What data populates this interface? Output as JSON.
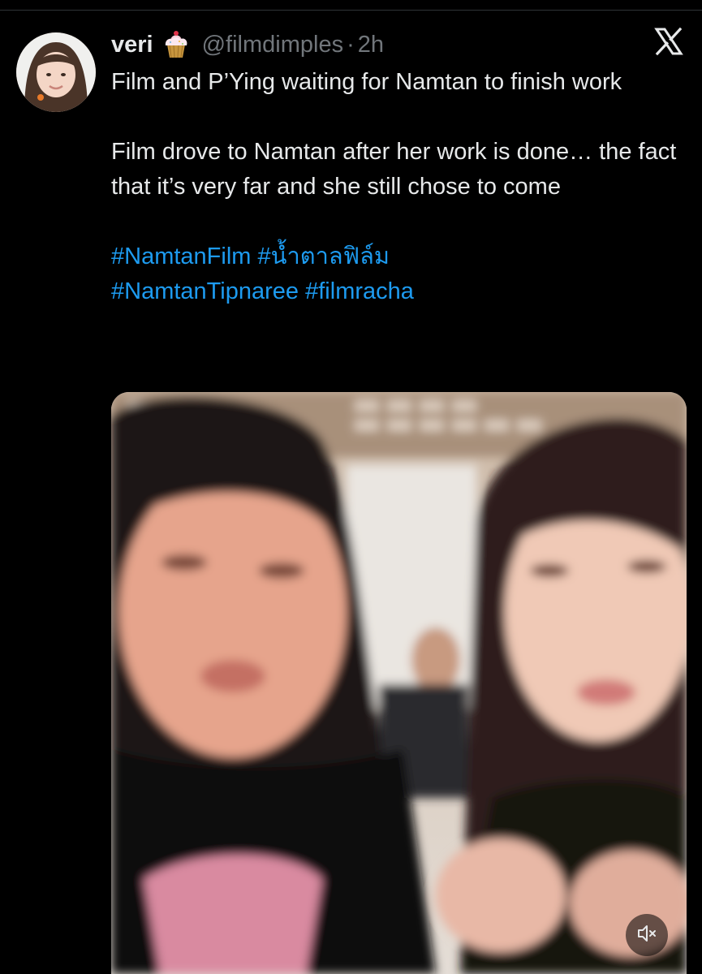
{
  "tweet": {
    "author": {
      "display_name": "veri",
      "emoji_icon": "cupcake-icon",
      "handle": "@filmdimples",
      "separator": "·",
      "time": "2h"
    },
    "text_line_1": "Film and P’Ying waiting for Namtan to finish work",
    "text_line_2": "Film drove to Namtan after her work is done… the fact that it’s very far and she still chose to come",
    "hashtags": [
      "#NamtanFilm",
      "#น้ำตาลฟิล์ม",
      "#NamtanTipnaree",
      "#filmracha"
    ],
    "media": {
      "type": "video",
      "muted": true
    }
  },
  "icons": {
    "close": "x-logo-icon",
    "mute": "speaker-muted-icon"
  },
  "colors": {
    "background": "#000000",
    "text": "#e7e9ea",
    "secondary": "#71767b",
    "link": "#1d9bf0"
  }
}
